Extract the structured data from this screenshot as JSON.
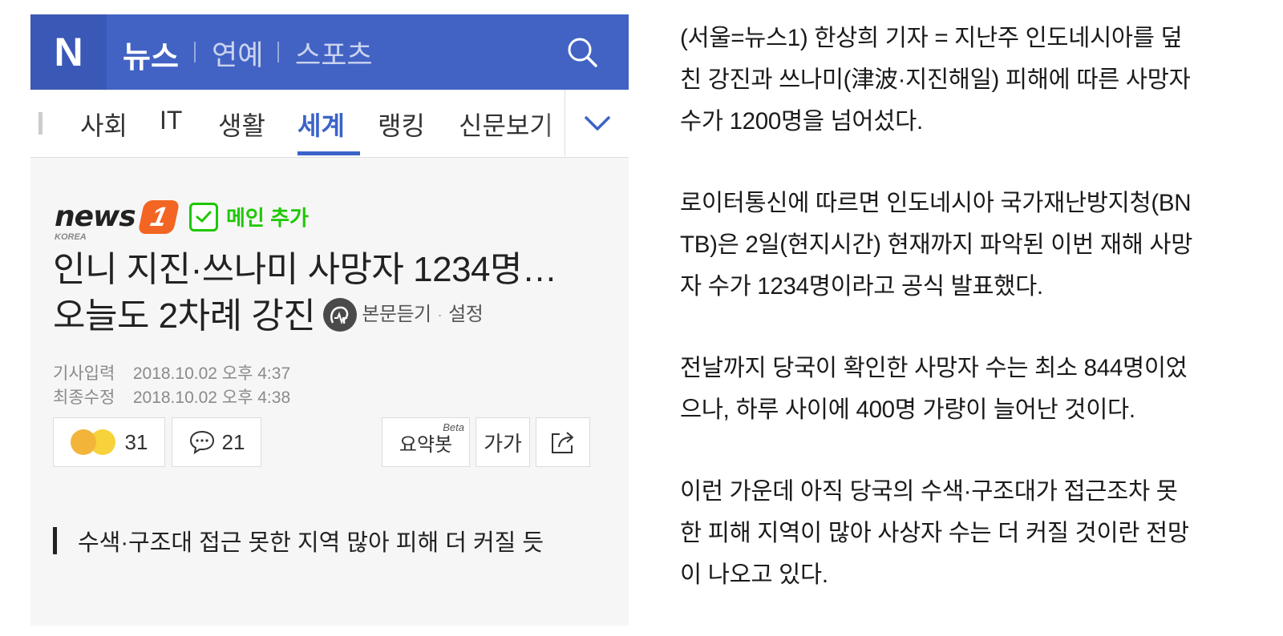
{
  "app": {
    "logo": "N",
    "brand": "뉴스",
    "top_links": [
      "연예",
      "스포츠"
    ],
    "search_icon": "search-icon"
  },
  "nav": {
    "items": [
      "사회",
      "IT",
      "생활",
      "세계",
      "랭킹",
      "신문보기"
    ],
    "active": "세계"
  },
  "article": {
    "press_name": "news",
    "press_number": "1",
    "press_sub": "KOREA",
    "main_add_label": "메인 추가",
    "title_line1": "인니 지진·쓰나미 사망자 1234명…",
    "title_line2": "오늘도 2차례 강진",
    "listen_label": "본문듣기",
    "settings_label": "설정",
    "input_label": "기사입력",
    "input_date": "2018.10.02 오후 4:37",
    "modified_label": "최종수정",
    "modified_date": "2018.10.02 오후 4:38",
    "reaction_count": "31",
    "comment_count": "21",
    "summary_label": "요약봇",
    "summary_badge": "Beta",
    "font_label": "가가",
    "subhead": "수색·구조대 접근 못한 지역 많아 피해 더 커질 듯"
  },
  "body_paragraphs": [
    [
      "(서울=뉴스1) 한상희 기자 = 지난주 인도네시아를 덮",
      "친 강진과 쓰나미(津波·지진해일) 피해에 따른 사망자",
      "수가 1200명을 넘어섰다."
    ],
    [
      "로이터통신에 따르면 인도네시아 국가재난방지청(BN",
      "TB)은 2일(현지시간) 현재까지 파악된 이번 재해 사망",
      "자 수가 1234명이라고 공식 발표했다."
    ],
    [
      "전날까지 당국이 확인한 사망자 수는 최소 844명이었",
      "으나, 하루 사이에 400명 가량이 늘어난 것이다."
    ],
    [
      "이런 가운데 아직 당국의 수색·구조대가 접근조차 못",
      "한 피해 지역이 많아 사상자 수는 더 커질 것이란 전망",
      "이 나오고 있다."
    ]
  ],
  "colors": {
    "header_blue": "#4263c4",
    "active_tab": "#3b63c8",
    "main_add_green": "#1ec800",
    "press_orange": "#f26522"
  }
}
